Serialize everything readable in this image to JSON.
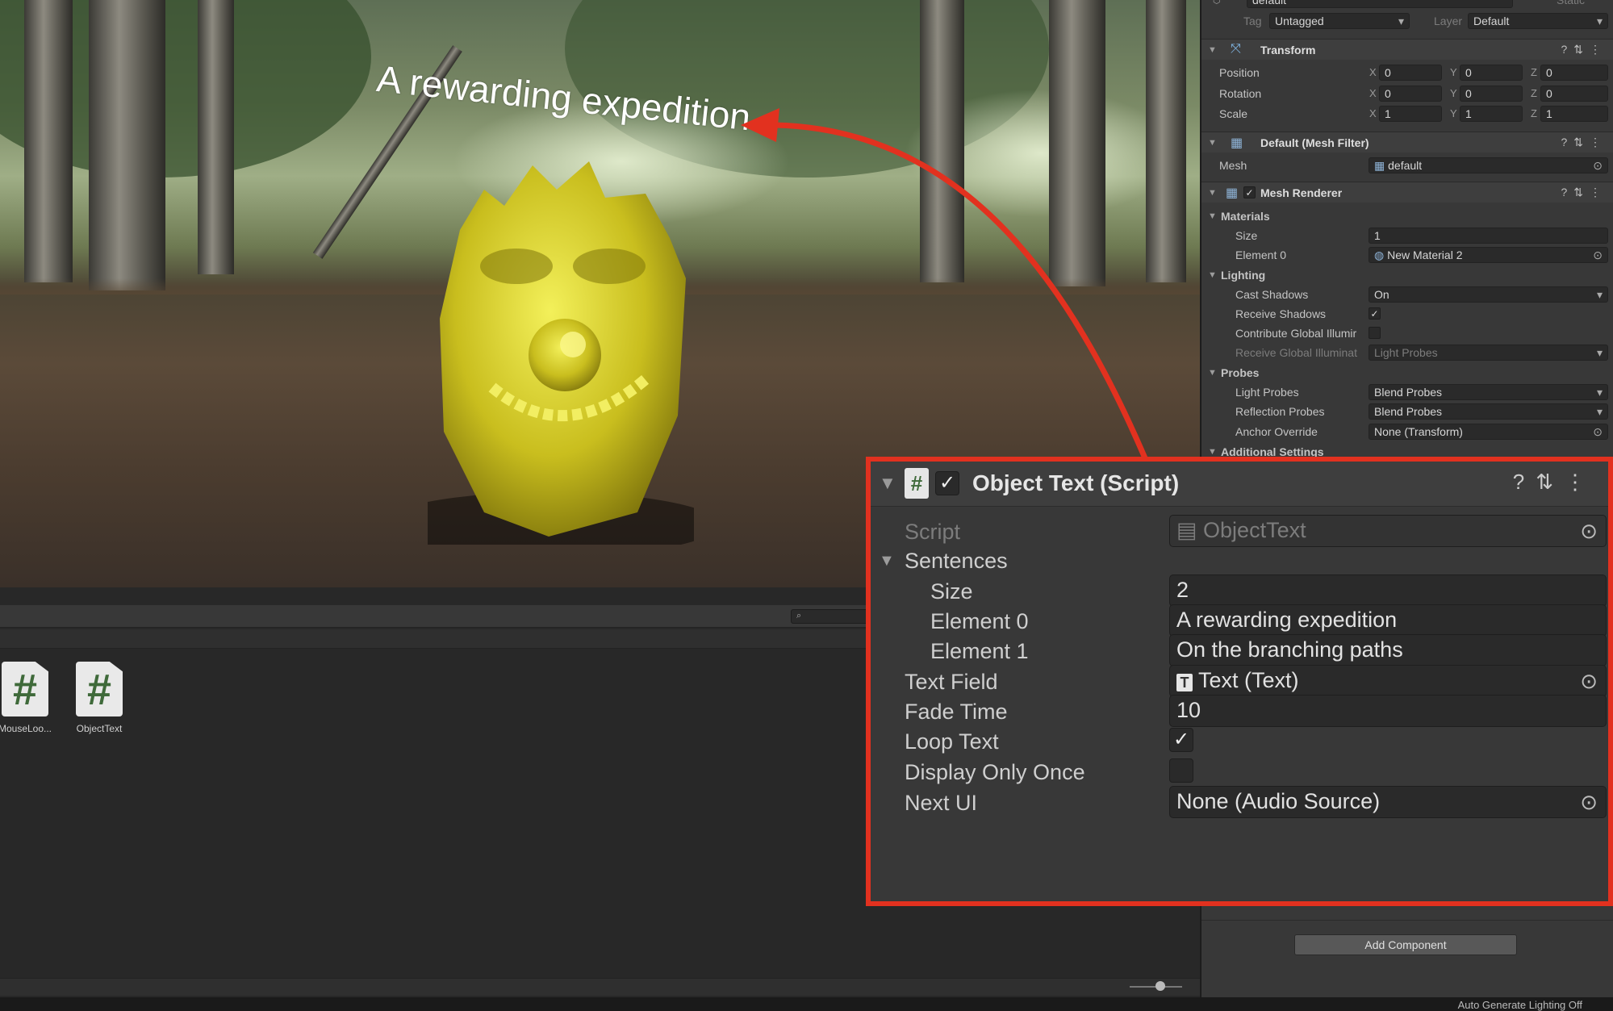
{
  "scene": {
    "caption": "A rewarding expedition"
  },
  "project": {
    "search_icon": "search-icon",
    "assets": [
      {
        "name": "MouseLoo...",
        "icon": "csharp-script-icon"
      },
      {
        "name": "ObjectText",
        "icon": "csharp-script-icon"
      }
    ],
    "status_text": "Auto Generate Lighting Off"
  },
  "inspector": {
    "object_name": "default",
    "static_label": "Static",
    "tag_label": "Tag",
    "tag_value": "Untagged",
    "layer_label": "Layer",
    "layer_value": "Default",
    "transform": {
      "title": "Transform",
      "position_label": "Position",
      "rotation_label": "Rotation",
      "scale_label": "Scale",
      "x": "X",
      "y": "Y",
      "z": "Z",
      "position": [
        "0",
        "0",
        "0"
      ],
      "rotation": [
        "0",
        "0",
        "0"
      ],
      "scale": [
        "1",
        "1",
        "1"
      ]
    },
    "mesh_filter": {
      "title": "Default (Mesh Filter)",
      "mesh_label": "Mesh",
      "mesh_value": "default"
    },
    "mesh_renderer": {
      "title": "Mesh Renderer",
      "materials": "Materials",
      "size_label": "Size",
      "size_value": "1",
      "element0_label": "Element 0",
      "element0_value": "New Material 2",
      "lighting": "Lighting",
      "cast_shadows_label": "Cast Shadows",
      "cast_shadows_value": "On",
      "receive_shadows_label": "Receive Shadows",
      "contribute_gi_label": "Contribute Global Illumir",
      "receive_gi_label": "Receive Global Illuminat",
      "receive_gi_value": "Light Probes",
      "probes": "Probes",
      "light_probes_label": "Light Probes",
      "light_probes_value": "Blend Probes",
      "reflection_probes_label": "Reflection Probes",
      "reflection_probes_value": "Blend Probes",
      "anchor_override_label": "Anchor Override",
      "anchor_override_value": "None (Transform)",
      "additional_settings": "Additional Settings"
    },
    "add_component": "Add Component"
  },
  "object_text": {
    "title": "Object Text (Script)",
    "script_label": "Script",
    "script_value": "ObjectText",
    "sentences_label": "Sentences",
    "size_label": "Size",
    "size_value": "2",
    "element0_label": "Element 0",
    "element0_value": "A rewarding expedition",
    "element1_label": "Element 1",
    "element1_value": "On the branching paths",
    "text_field_label": "Text Field",
    "text_field_value": "Text (Text)",
    "fade_time_label": "Fade Time",
    "fade_time_value": "10",
    "loop_text_label": "Loop Text",
    "loop_text_checked": true,
    "display_once_label": "Display Only Once",
    "display_once_checked": false,
    "next_ui_label": "Next UI",
    "next_ui_value": "None (Audio Source)"
  },
  "colors": {
    "highlight": "#e2311f",
    "panel": "#383838",
    "field": "#2a2a2a"
  }
}
